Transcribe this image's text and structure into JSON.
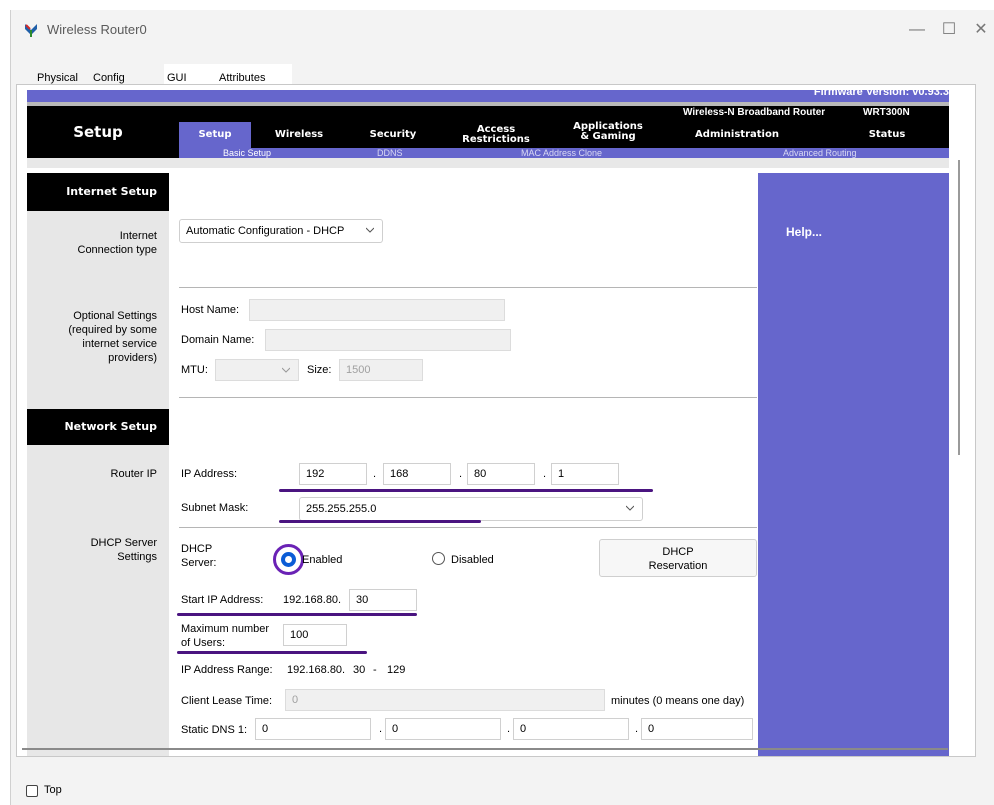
{
  "window": {
    "title": "Wireless Router0",
    "minimize": "—",
    "maximize": "☐",
    "close": "✕"
  },
  "tabs": {
    "physical": "Physical",
    "config": "Config",
    "gui": "GUI",
    "attributes": "Attributes"
  },
  "header": {
    "firmware": "Firmware Version: v0.93.3",
    "product": "Wireless-N Broadband Router",
    "model": "WRT300N",
    "section_title": "Setup",
    "nav": {
      "setup": "Setup",
      "wireless": "Wireless",
      "security": "Security",
      "access_1": "Access",
      "access_2": "Restrictions",
      "apps_1": "Applications",
      "apps_2": "& Gaming",
      "administration": "Administration",
      "status": "Status"
    },
    "subnav": {
      "basic_setup": "Basic Setup",
      "ddns": "DDNS",
      "mac_clone": "MAC Address Clone",
      "advanced_routing": "Advanced Routing"
    }
  },
  "left": {
    "internet_setup": "Internet Setup",
    "connection_type_1": "Internet",
    "connection_type_2": "Connection type",
    "optional_1": "Optional Settings",
    "optional_2": "(required by some",
    "optional_3": "internet service",
    "optional_4": "providers)",
    "network_setup": "Network Setup",
    "router_ip": "Router IP",
    "dhcp_1": "DHCP Server",
    "dhcp_2": "Settings"
  },
  "internet": {
    "connection_type": "Automatic Configuration - DHCP",
    "host_name_label": "Host Name:",
    "host_name_value": "",
    "domain_name_label": "Domain Name:",
    "domain_name_value": "",
    "mtu_label": "MTU:",
    "mtu_value": "",
    "size_label": "Size:",
    "size_value": "1500"
  },
  "network": {
    "ip_label": "IP Address:",
    "ip": [
      "192",
      "168",
      "80",
      "1"
    ],
    "dot": ".",
    "subnet_label": "Subnet Mask:",
    "subnet": "255.255.255.0"
  },
  "dhcp": {
    "server_label_1": "DHCP",
    "server_label_2": "Server:",
    "enabled": "Enabled",
    "disabled": "Disabled",
    "reservation_1": "DHCP",
    "reservation_2": "Reservation",
    "start_label": "Start IP Address:",
    "start_prefix": "192.168.80.",
    "start_value": "30",
    "max_label_1": "Maximum number",
    "max_label_2": "of Users:",
    "max_value": "100",
    "range_label": "IP Address Range:",
    "range_prefix": "192.168.80.",
    "range_start": "30",
    "range_dash": "-",
    "range_end": "129",
    "lease_label": "Client Lease Time:",
    "lease_value": "0",
    "lease_unit": "minutes (0 means one day)",
    "dns1_label": "Static DNS 1:",
    "dns1": [
      "0",
      "0",
      "0",
      "0"
    ]
  },
  "help": {
    "label": "Help..."
  },
  "footer": {
    "top_label": "Top"
  }
}
